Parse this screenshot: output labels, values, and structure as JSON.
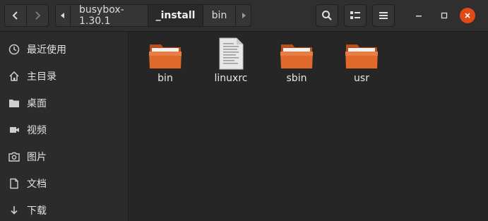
{
  "window": {
    "controls": {
      "minimize": "minimize",
      "maximize": "maximize",
      "close": "close"
    }
  },
  "header": {
    "back_icon": "chevron-left-icon",
    "forward_icon": "chevron-right-icon",
    "path": [
      {
        "label": "busybox-1.30.1",
        "current": false
      },
      {
        "label": "_install",
        "current": true
      },
      {
        "label": "bin",
        "current": false
      }
    ],
    "search_icon": "search-icon",
    "view_icon": "list-view-icon",
    "menu_icon": "hamburger-menu-icon"
  },
  "sidebar": {
    "items": [
      {
        "label": "最近使用",
        "icon": "clock-icon"
      },
      {
        "label": "主目录",
        "icon": "home-icon"
      },
      {
        "label": "桌面",
        "icon": "folder-icon"
      },
      {
        "label": "视频",
        "icon": "video-icon"
      },
      {
        "label": "图片",
        "icon": "camera-icon"
      },
      {
        "label": "文档",
        "icon": "document-icon"
      },
      {
        "label": "下载",
        "icon": "download-icon"
      }
    ]
  },
  "files": [
    {
      "name": "bin",
      "type": "folder"
    },
    {
      "name": "linuxrc",
      "type": "file"
    },
    {
      "name": "sbin",
      "type": "folder"
    },
    {
      "name": "usr",
      "type": "folder"
    }
  ],
  "colors": {
    "folder": "#e06a2e",
    "close_button": "#df4a16",
    "background": "#262626"
  }
}
